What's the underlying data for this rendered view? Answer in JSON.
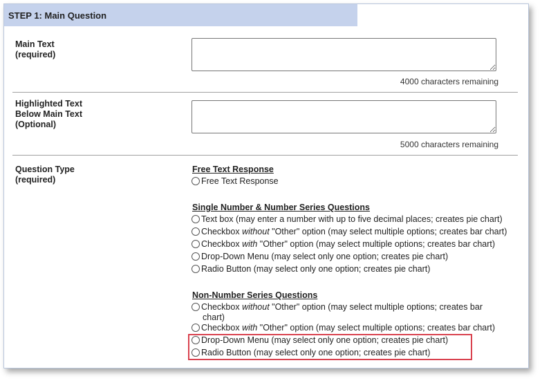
{
  "step_header": "STEP 1: Main Question",
  "main_text": {
    "label_line1": "Main Text",
    "label_line2": "(required)",
    "value": "",
    "remaining": "4000 characters remaining"
  },
  "highlighted_text": {
    "label_line1": "Highlighted Text",
    "label_line2": "Below Main Text",
    "label_line3": "(Optional)",
    "value": "",
    "remaining": "5000 characters remaining"
  },
  "question_type": {
    "label_line1": "Question Type",
    "label_line2": "(required)",
    "groups": [
      {
        "title": "Free Text Response",
        "options": [
          {
            "pre": "Free Text Response"
          }
        ]
      },
      {
        "title": "Single Number & Number Series Questions",
        "options": [
          {
            "pre": "Text box (may enter a number with up to five decimal places; creates pie chart)"
          },
          {
            "pre": "Checkbox ",
            "em": "without",
            "post": " \"Other\" option (may select multiple options; creates bar chart)"
          },
          {
            "pre": "Checkbox ",
            "em": "with",
            "post": " \"Other\" option (may select multiple options; creates bar chart)"
          },
          {
            "pre": "Drop-Down Menu (may select only one option; creates pie chart)"
          },
          {
            "pre": "Radio Button (may select only one option; creates pie chart)"
          }
        ]
      },
      {
        "title": "Non-Number Series Questions",
        "options": [
          {
            "pre": "Checkbox ",
            "em": "without",
            "post": " \"Other\" option (may select multiple options; creates bar",
            "cont": "chart)"
          },
          {
            "pre": "Checkbox ",
            "em": "with",
            "post": " \"Other\" option (may select multiple options; creates bar chart)"
          },
          {
            "pre": "Drop-Down Menu (may select only one option; creates pie chart)"
          },
          {
            "pre": "Radio Button (may select only one option; creates pie chart)"
          }
        ]
      }
    ]
  },
  "colors": {
    "header_bg": "#c5d2ec",
    "highlight_border": "#d9414e"
  }
}
